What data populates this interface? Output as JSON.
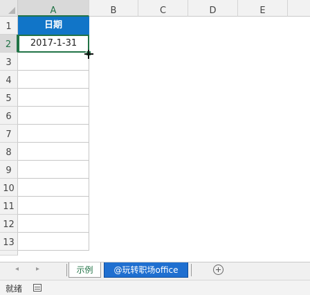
{
  "columns": [
    "A",
    "B",
    "C",
    "D",
    "E"
  ],
  "rows": [
    "1",
    "2",
    "3",
    "4",
    "5",
    "6",
    "7",
    "8",
    "9",
    "10",
    "11",
    "12",
    "13"
  ],
  "cells": {
    "A1": "日期",
    "A2": "2017-1-31"
  },
  "sheets": [
    "示例",
    "@玩转职场office"
  ],
  "status": {
    "ready": "就绪"
  },
  "colors": {
    "header_fill": "#1175c8",
    "excel_green": "#217346",
    "active_tab": "#1f6fd0"
  }
}
